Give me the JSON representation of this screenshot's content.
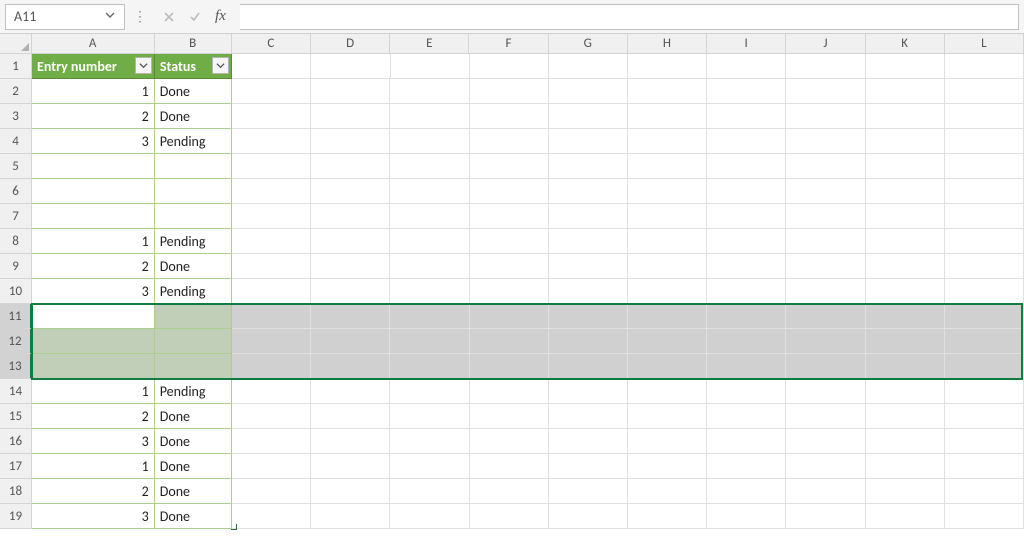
{
  "name_box": {
    "value": "A11"
  },
  "fx_label": "fx",
  "columns": [
    "A",
    "B",
    "C",
    "D",
    "E",
    "F",
    "G",
    "H",
    "I",
    "J",
    "K",
    "L"
  ],
  "column_widths": {
    "A": 124,
    "B": 78,
    "other": 80
  },
  "row_count": 19,
  "selected_rows": [
    11,
    12,
    13
  ],
  "active_cell": "A11",
  "table": {
    "header": {
      "entry": "Entry number",
      "status": "Status"
    },
    "rows": [
      {
        "entry": "1",
        "status": "Done"
      },
      {
        "entry": "2",
        "status": "Done"
      },
      {
        "entry": "3",
        "status": "Pending"
      },
      {
        "entry": "",
        "status": ""
      },
      {
        "entry": "",
        "status": ""
      },
      {
        "entry": "",
        "status": ""
      },
      {
        "entry": "1",
        "status": "Pending"
      },
      {
        "entry": "2",
        "status": "Done"
      },
      {
        "entry": "3",
        "status": "Pending"
      },
      {
        "entry": "",
        "status": ""
      },
      {
        "entry": "",
        "status": ""
      },
      {
        "entry": "",
        "status": ""
      },
      {
        "entry": "1",
        "status": "Pending"
      },
      {
        "entry": "2",
        "status": "Done"
      },
      {
        "entry": "3",
        "status": "Done"
      },
      {
        "entry": "1",
        "status": "Done"
      },
      {
        "entry": "2",
        "status": "Done"
      },
      {
        "entry": "3",
        "status": "Done"
      }
    ]
  }
}
